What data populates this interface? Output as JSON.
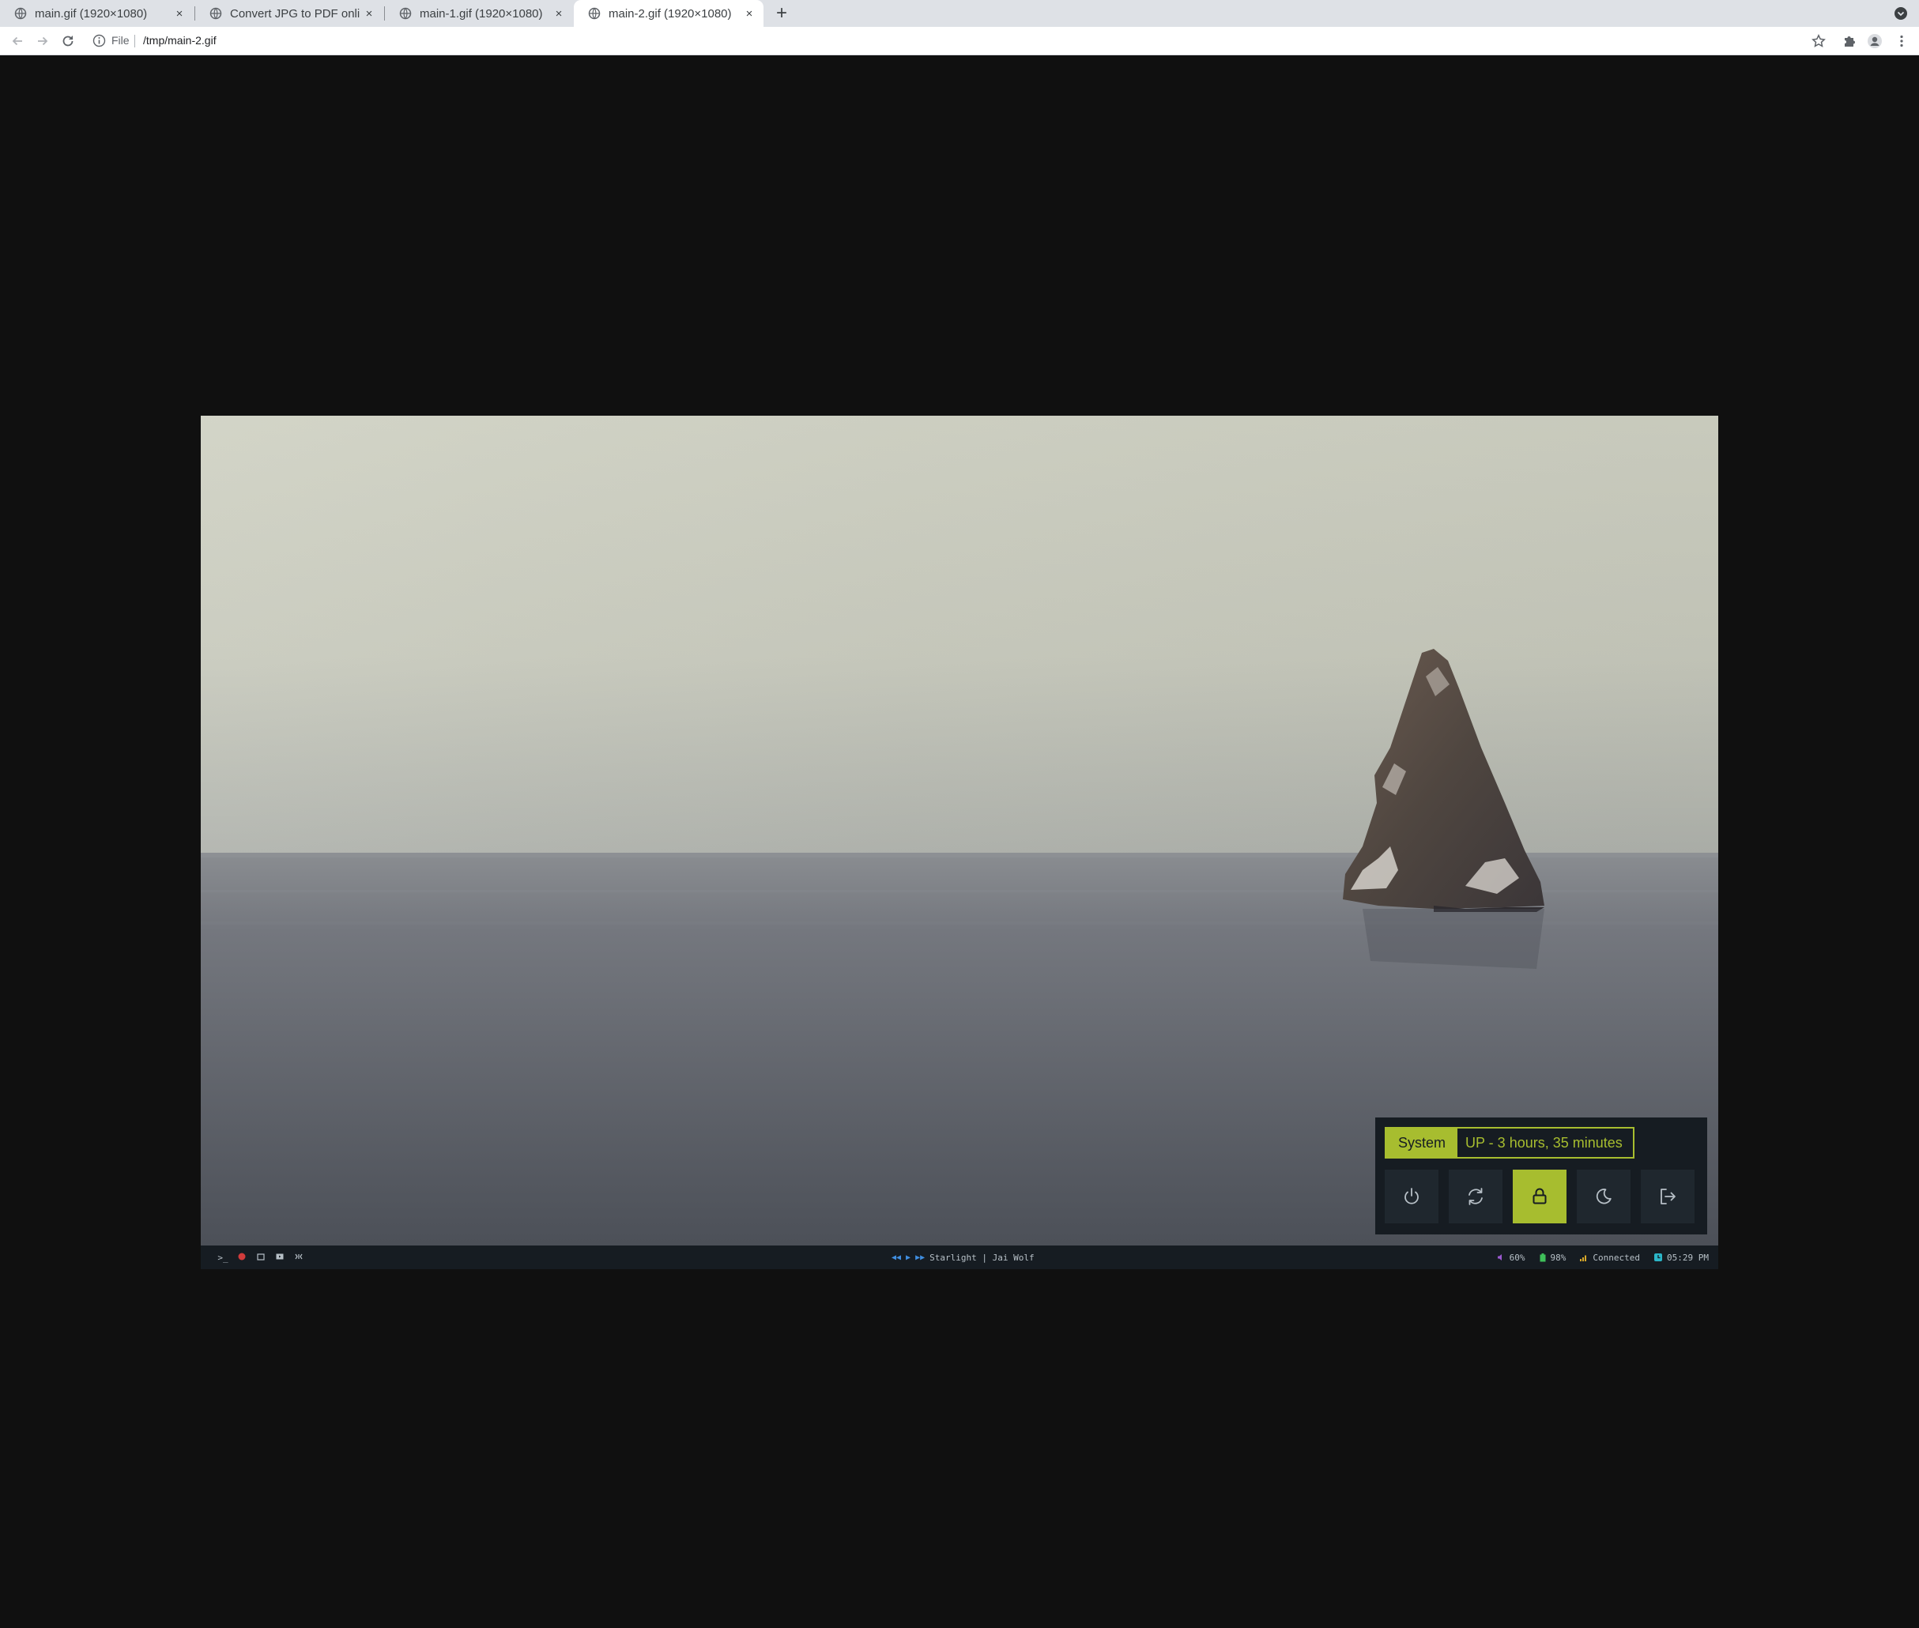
{
  "browser": {
    "tabs": [
      {
        "title": "main.gif (1920×1080)",
        "active": false
      },
      {
        "title": "Convert JPG to PDF online",
        "active": false
      },
      {
        "title": "main-1.gif (1920×1080)",
        "active": false
      },
      {
        "title": "main-2.gif (1920×1080)",
        "active": true
      }
    ],
    "tab_close_glyph": "×",
    "new_tab_glyph": "+",
    "omnibox": {
      "scheme_label": "File",
      "url": "/tmp/main-2.gif"
    }
  },
  "desktop": {
    "powermenu": {
      "prompt_label": "System",
      "uptime": "UP - 3 hours, 35 minutes",
      "buttons": [
        {
          "icon": "power-icon",
          "selected": false
        },
        {
          "icon": "reboot-icon",
          "selected": false
        },
        {
          "icon": "lock-icon",
          "selected": true
        },
        {
          "icon": "suspend-icon",
          "selected": false
        },
        {
          "icon": "logout-icon",
          "selected": false
        }
      ]
    },
    "bar": {
      "launcher_glyph": ">_",
      "now_playing": "Starlight | Jai Wolf",
      "volume": "60%",
      "battery": "98%",
      "network": "Connected",
      "time": "05:29 PM"
    }
  },
  "colors": {
    "accent": "#a7bd2f",
    "bar_bg": "#161c22",
    "media_blue": "#3f8ee0",
    "page_bg": "#101010"
  }
}
